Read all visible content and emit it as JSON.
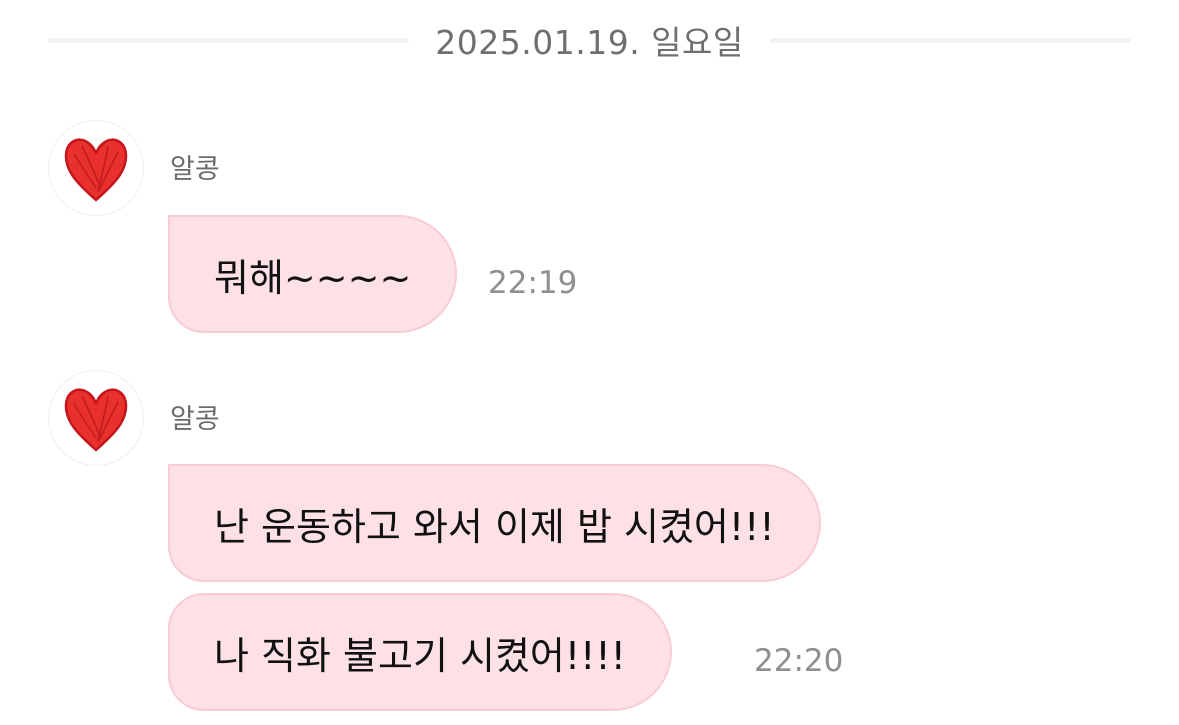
{
  "date_divider": "2025.01.19. 일요일",
  "accent_bubble_color": "#fde1e6",
  "groups": [
    {
      "avatar_icon": "red-heart-icon",
      "sender": "알콩",
      "messages": [
        {
          "text": "뭐해~~~~",
          "time": "22:19"
        }
      ]
    },
    {
      "avatar_icon": "red-heart-icon",
      "sender": "알콩",
      "messages": [
        {
          "text": "난 운동하고 와서 이제 밥 시켰어!!!",
          "time": ""
        },
        {
          "text": "나 직화 불고기 시켰어!!!!",
          "time": "22:20"
        }
      ]
    }
  ]
}
